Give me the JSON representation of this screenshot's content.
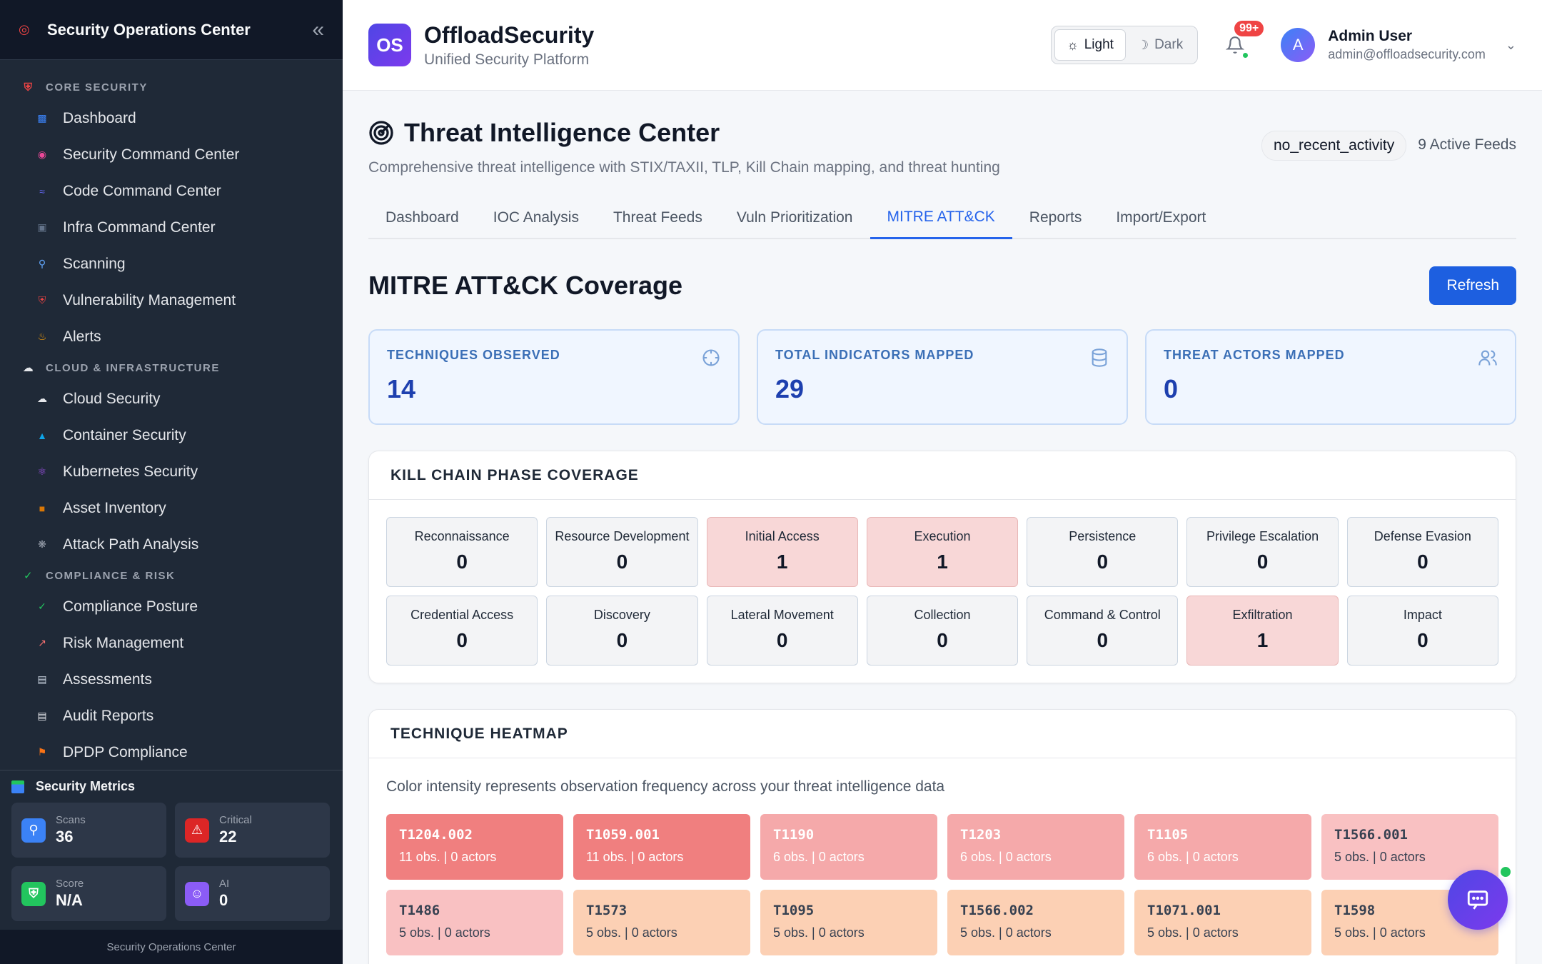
{
  "sidebar": {
    "title": "Security Operations Center",
    "sections": [
      {
        "label": "CORE SECURITY",
        "icon": "shield-icon",
        "items": [
          {
            "label": "Dashboard",
            "icon": "bar-chart-icon"
          },
          {
            "label": "Security Command Center",
            "icon": "brain-icon"
          },
          {
            "label": "Code Command Center",
            "icon": "dna-icon"
          },
          {
            "label": "Infra Command Center",
            "icon": "monitor-icon"
          },
          {
            "label": "Scanning",
            "icon": "magnifier-icon"
          },
          {
            "label": "Vulnerability Management",
            "icon": "shield-icon"
          },
          {
            "label": "Alerts",
            "icon": "bell-icon"
          }
        ]
      },
      {
        "label": "CLOUD & INFRASTRUCTURE",
        "icon": "cloud-icon",
        "items": [
          {
            "label": "Cloud Security",
            "icon": "cloud-icon"
          },
          {
            "label": "Container Security",
            "icon": "whale-icon"
          },
          {
            "label": "Kubernetes Security",
            "icon": "atom-icon"
          },
          {
            "label": "Asset Inventory",
            "icon": "package-icon"
          },
          {
            "label": "Attack Path Analysis",
            "icon": "network-icon"
          }
        ]
      },
      {
        "label": "COMPLIANCE & RISK",
        "icon": "check-icon",
        "items": [
          {
            "label": "Compliance Posture",
            "icon": "check-icon"
          },
          {
            "label": "Risk Management",
            "icon": "trend-chart-icon"
          },
          {
            "label": "Assessments",
            "icon": "clipboard-icon"
          },
          {
            "label": "Audit Reports",
            "icon": "document-icon"
          },
          {
            "label": "DPDP Compliance",
            "icon": "flag-icon"
          }
        ]
      }
    ],
    "metrics": {
      "title": "Security Metrics",
      "cards": [
        {
          "label": "Scans",
          "value": "36",
          "icon": "magnifier-icon",
          "color": "#3b82f6"
        },
        {
          "label": "Critical",
          "value": "22",
          "icon": "warning-icon",
          "color": "#dc2626"
        },
        {
          "label": "Score",
          "value": "N/A",
          "icon": "shield-icon",
          "color": "#22c55e"
        },
        {
          "label": "AI",
          "value": "0",
          "icon": "robot-icon",
          "color": "#8b5cf6"
        }
      ]
    },
    "footer": "Security Operations Center"
  },
  "topbar": {
    "logo_text": "OS",
    "brand_name": "OffloadSecurity",
    "brand_sub": "Unified Security Platform",
    "theme_light": "Light",
    "theme_dark": "Dark",
    "notif_badge": "99+",
    "avatar_letter": "A",
    "user_name": "Admin User",
    "user_email": "admin@offloadsecurity.com"
  },
  "page": {
    "title": "Threat Intelligence Center",
    "subtitle": "Comprehensive threat intelligence with STIX/TAXII, TLP, Kill Chain mapping, and threat hunting",
    "status_badge": "no_recent_activity",
    "active_feeds": "9 Active Feeds",
    "tabs": [
      "Dashboard",
      "IOC Analysis",
      "Threat Feeds",
      "Vuln Prioritization",
      "MITRE ATT&CK",
      "Reports",
      "Import/Export"
    ],
    "active_tab": 4
  },
  "coverage": {
    "title": "MITRE ATT&CK Coverage",
    "refresh_label": "Refresh",
    "stats": [
      {
        "label": "TECHNIQUES OBSERVED",
        "value": "14",
        "icon": "crosshair-icon"
      },
      {
        "label": "TOTAL INDICATORS MAPPED",
        "value": "29",
        "icon": "database-icon"
      },
      {
        "label": "THREAT ACTORS MAPPED",
        "value": "0",
        "icon": "users-icon"
      }
    ]
  },
  "kill_chain": {
    "title": "KILL CHAIN PHASE COVERAGE",
    "phases": [
      {
        "name": "Reconnaissance",
        "count": "0"
      },
      {
        "name": "Resource Development",
        "count": "0"
      },
      {
        "name": "Initial Access",
        "count": "1"
      },
      {
        "name": "Execution",
        "count": "1"
      },
      {
        "name": "Persistence",
        "count": "0"
      },
      {
        "name": "Privilege Escalation",
        "count": "0"
      },
      {
        "name": "Defense Evasion",
        "count": "0"
      },
      {
        "name": "Credential Access",
        "count": "0"
      },
      {
        "name": "Discovery",
        "count": "0"
      },
      {
        "name": "Lateral Movement",
        "count": "0"
      },
      {
        "name": "Collection",
        "count": "0"
      },
      {
        "name": "Command & Control",
        "count": "0"
      },
      {
        "name": "Exfiltration",
        "count": "1"
      },
      {
        "name": "Impact",
        "count": "0"
      }
    ]
  },
  "heatmap": {
    "title": "TECHNIQUE HEATMAP",
    "description": "Color intensity represents observation frequency across your threat intelligence data",
    "cells": [
      {
        "id": "T1204.002",
        "meta": "11 obs. | 0 actors",
        "bg": "#f07f7f",
        "fg": "#ffffff"
      },
      {
        "id": "T1059.001",
        "meta": "11 obs. | 0 actors",
        "bg": "#f07f7f",
        "fg": "#ffffff"
      },
      {
        "id": "T1190",
        "meta": "6 obs. | 0 actors",
        "bg": "#f5a9aa",
        "fg": "#ffffff"
      },
      {
        "id": "T1203",
        "meta": "6 obs. | 0 actors",
        "bg": "#f5a9aa",
        "fg": "#ffffff"
      },
      {
        "id": "T1105",
        "meta": "6 obs. | 0 actors",
        "bg": "#f5a9aa",
        "fg": "#ffffff"
      },
      {
        "id": "T1566.001",
        "meta": "5 obs. | 0 actors",
        "bg": "#f9c1c2",
        "fg": "#374151"
      },
      {
        "id": "T1486",
        "meta": "5 obs. | 0 actors",
        "bg": "#f9c1c2",
        "fg": "#374151"
      },
      {
        "id": "T1573",
        "meta": "5 obs. | 0 actors",
        "bg": "#fcd0b4",
        "fg": "#374151"
      },
      {
        "id": "T1095",
        "meta": "5 obs. | 0 actors",
        "bg": "#fcd0b4",
        "fg": "#374151"
      },
      {
        "id": "T1566.002",
        "meta": "5 obs. | 0 actors",
        "bg": "#fcd0b4",
        "fg": "#374151"
      },
      {
        "id": "T1071.001",
        "meta": "5 obs. | 0 actors",
        "bg": "#fcd0b4",
        "fg": "#374151"
      },
      {
        "id": "T1598",
        "meta": "5 obs. | 0 actors",
        "bg": "#fcd0b4",
        "fg": "#374151"
      }
    ]
  }
}
